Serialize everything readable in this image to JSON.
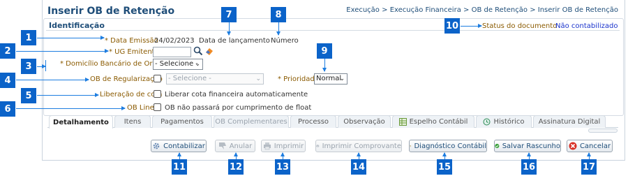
{
  "header": {
    "title": "Inserir OB de Retenção",
    "breadcrumb": [
      "Execução",
      ">",
      "Execução Financeira",
      ">",
      "OB de Retenção",
      ">",
      "Inserir OB de Retenção"
    ]
  },
  "section": {
    "title": "Identificação"
  },
  "form": {
    "data_emissao_label": "* Data Emissão",
    "data_emissao_value": "24/02/2023",
    "data_lancamento_label": "Data de lançamento",
    "numero_label": "Número",
    "status_label": "Status do documento",
    "status_value": "Não contabilizado",
    "ug_emitente_label": "* UG Emitente",
    "ug_emitente_value": "",
    "domicilio_label": "* Domicílio Bancário de Origem",
    "domicilio_value": "- Selecione -",
    "ob_regularizacao_label": "OB de Regularização",
    "ob_regularizacao_select": "- Selecione -",
    "prioridade_label": "* Prioridade",
    "prioridade_value": "Normal",
    "liberacao_label": "Liberação de cota",
    "liberacao_checkbox_text": "Liberar cota financeira automaticamente",
    "ob_line_label": "OB Line",
    "ob_line_checkbox_text": "OB não passará por cumprimento de float"
  },
  "tabs": [
    {
      "label": "Detalhamento",
      "state": "active"
    },
    {
      "label": "Itens",
      "state": "normal"
    },
    {
      "label": "Pagamentos",
      "state": "normal"
    },
    {
      "label": "OB Complementares",
      "state": "disabled"
    },
    {
      "label": "Processo",
      "state": "normal"
    },
    {
      "label": "Observação",
      "state": "normal"
    },
    {
      "label": "Espelho Contábil",
      "state": "normal"
    },
    {
      "label": "Histórico",
      "state": "normal"
    },
    {
      "label": "Assinatura Digital",
      "state": "normal"
    }
  ],
  "toolbar": {
    "contabilizar": "Contabilizar",
    "anular": "Anular",
    "imprimir": "Imprimir",
    "imprimir_comprovante": "Imprimir Comprovante",
    "diagnostico": "Diagnóstico Contábil",
    "salvar_rascunho": "Salvar Rascunho",
    "cancelar": "Cancelar"
  },
  "callouts": [
    "1",
    "2",
    "3",
    "4",
    "5",
    "6",
    "7",
    "8",
    "9",
    "10",
    "11",
    "12",
    "13",
    "14",
    "15",
    "16",
    "17"
  ],
  "colors": {
    "callout": "#0b63c9",
    "arrow": "#1d7de0",
    "title": "#1f4e79",
    "label": "#8a5a00"
  },
  "icons": [
    "search-icon",
    "eraser-icon",
    "spreadsheet-icon",
    "history-icon",
    "gear-icon",
    "thumbs-down-icon",
    "printer-icon",
    "scale-icon",
    "check-icon",
    "cancel-icon"
  ]
}
